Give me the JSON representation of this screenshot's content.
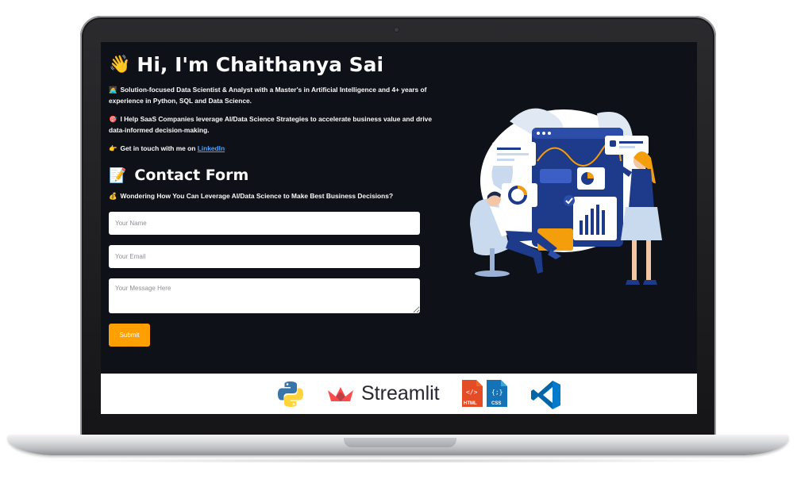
{
  "hero": {
    "wave_emoji": "👋",
    "title": "Hi, I'm Chaithanya Sai",
    "intro_emoji": "🧑‍💻",
    "intro": "Solution-focused Data Scientist & Analyst with a Master's in Artificial Intelligence and 4+ years of experience in Python, SQL and Data Science.",
    "help_emoji": "🎯",
    "help": "I Help SaaS Companies leverage AI/Data Science Strategies to accelerate business value and drive data-informed decision-making.",
    "contact_emoji": "👉",
    "contact_prefix": "Get in touch with me on ",
    "contact_link": "LinkedIn"
  },
  "form": {
    "title_emoji": "📝",
    "title": "Contact Form",
    "subtitle_emoji": "💰",
    "subtitle": "Wondering How You Can Leverage AI/Data Science to Make Best Business Decisions?",
    "name_placeholder": "Your Name",
    "email_placeholder": "Your Email",
    "message_placeholder": "Your Message Here",
    "submit_label": "Submit"
  },
  "tech_banner": {
    "streamlit_label": "Streamlit",
    "html_label": "HTML",
    "css_label": "CSS"
  },
  "colors": {
    "background": "#0e1117",
    "accent": "#ff9f00",
    "link": "#4ea1ff"
  }
}
